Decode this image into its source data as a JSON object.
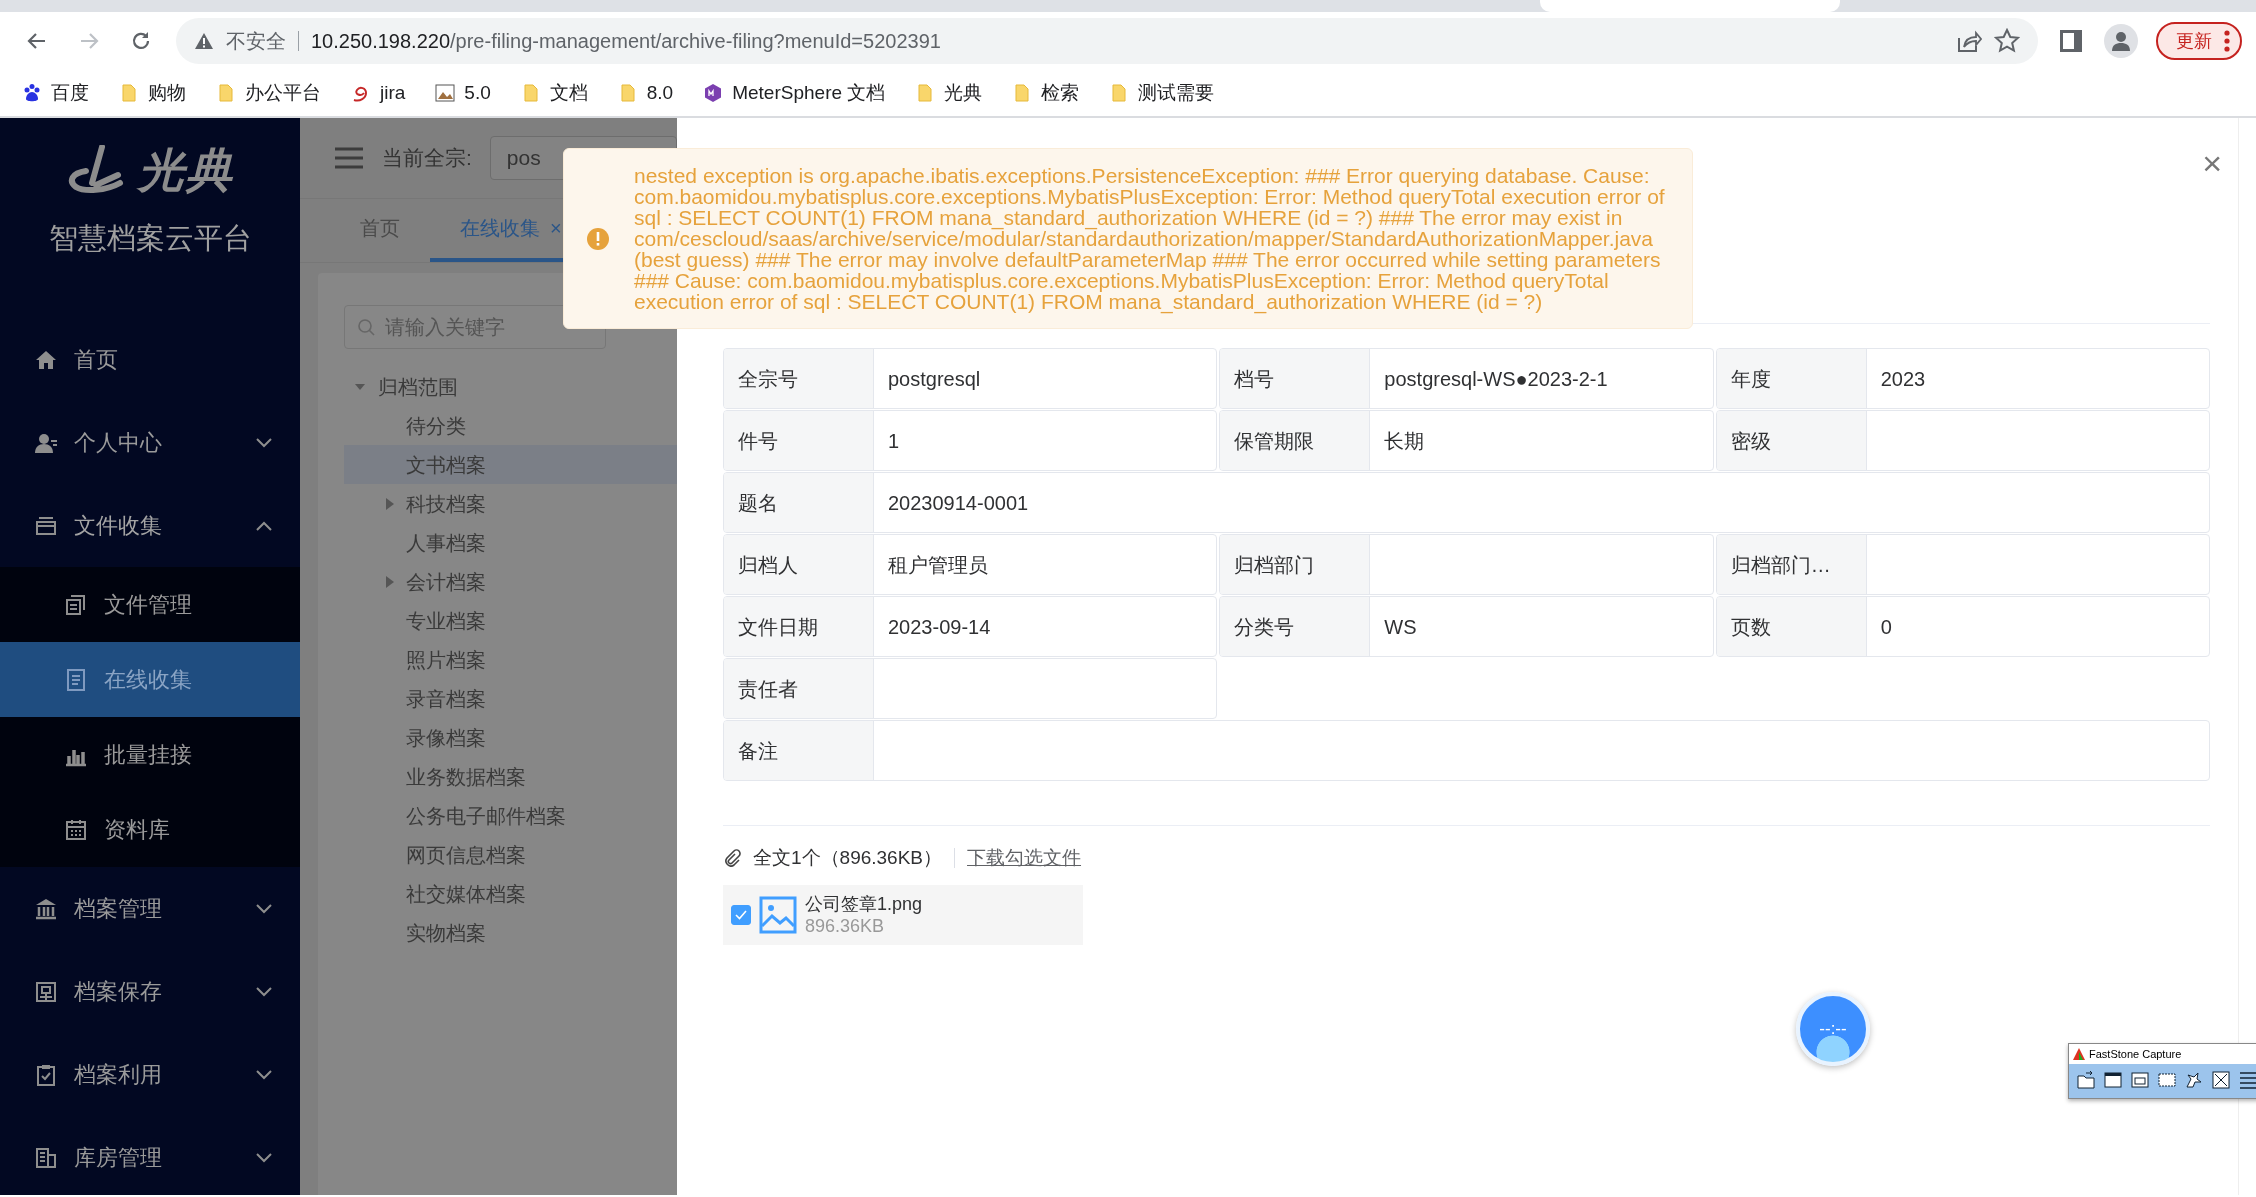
{
  "browser": {
    "security": "不安全",
    "url_host": "10.250.198.220",
    "url_path": "/pre-filing-management/archive-filing?menuId=5202391",
    "update_button": "更新",
    "bookmarks": [
      {
        "label": "百度",
        "kind": "paw"
      },
      {
        "label": "购物",
        "kind": "folder"
      },
      {
        "label": "办公平台",
        "kind": "folder"
      },
      {
        "label": "jira",
        "kind": "swirl"
      },
      {
        "label": "5.0",
        "kind": "image"
      },
      {
        "label": "文档",
        "kind": "folder"
      },
      {
        "label": "8.0",
        "kind": "folder"
      },
      {
        "label": "MeterSphere 文档",
        "kind": "hexagon"
      },
      {
        "label": "光典",
        "kind": "folder"
      },
      {
        "label": "检索",
        "kind": "folder"
      },
      {
        "label": "测试需要",
        "kind": "folder"
      }
    ]
  },
  "sidebar": {
    "logo_text": "光典",
    "platform_name": "智慧档案云平台",
    "items": [
      {
        "label": "首页"
      },
      {
        "label": "个人中心",
        "expanded": false
      },
      {
        "label": "文件收集",
        "expanded": true,
        "children": [
          {
            "label": "文件管理",
            "selected": false
          },
          {
            "label": "在线收集",
            "selected": true
          },
          {
            "label": "批量挂接",
            "selected": false
          },
          {
            "label": "资料库",
            "selected": false
          }
        ]
      },
      {
        "label": "档案管理",
        "expanded": false
      },
      {
        "label": "档案保存",
        "expanded": false
      },
      {
        "label": "档案利用",
        "expanded": false
      },
      {
        "label": "库房管理",
        "expanded": false
      }
    ]
  },
  "header": {
    "fonds_label": "当前全宗:",
    "fonds_value": "pos"
  },
  "tabs": [
    {
      "label": "首页",
      "selected": false
    },
    {
      "label": "在线收集",
      "selected": true,
      "close": "×"
    }
  ],
  "tree": {
    "search_placeholder": "请输入关键字",
    "root": {
      "label": "归档范围",
      "expanded": true,
      "children": [
        {
          "label": "待分类",
          "has_children": false,
          "selected": false
        },
        {
          "label": "文书档案",
          "has_children": false,
          "selected": true
        },
        {
          "label": "科技档案",
          "has_children": true,
          "selected": false
        },
        {
          "label": "人事档案",
          "has_children": false,
          "selected": false
        },
        {
          "label": "会计档案",
          "has_children": true,
          "selected": false
        },
        {
          "label": "专业档案",
          "has_children": false,
          "selected": false
        },
        {
          "label": "照片档案",
          "has_children": false,
          "selected": false
        },
        {
          "label": "录音档案",
          "has_children": false,
          "selected": false
        },
        {
          "label": "录像档案",
          "has_children": false,
          "selected": false
        },
        {
          "label": "业务数据档案",
          "has_children": false,
          "selected": false
        },
        {
          "label": "公务电子邮件档案",
          "has_children": false,
          "selected": false
        },
        {
          "label": "网页信息档案",
          "has_children": false,
          "selected": false
        },
        {
          "label": "社交媒体档案",
          "has_children": false,
          "selected": false
        },
        {
          "label": "实物档案",
          "has_children": false,
          "selected": false
        }
      ]
    }
  },
  "error_toast": {
    "message": "nested exception is org.apache.ibatis.exceptions.PersistenceException: ### Error querying database. Cause: com.baomidou.mybatisplus.core.exceptions.MybatisPlusException: Error: Method queryTotal execution error of sql : SELECT COUNT(1) FROM mana_standard_authorization WHERE (id = ?) ### The error may exist in com/cescloud/saas/archive/service/modular/standardauthorization/mapper/StandardAuthorizationMapper.java (best guess) ### The error may involve defaultParameterMap ### The error occurred while setting parameters ### Cause: com.baomidou.mybatisplus.core.exceptions.MybatisPlusException: Error: Method queryTotal execution error of sql : SELECT COUNT(1) FROM mana_standard_authorization WHERE (id = ?)"
  },
  "detail": {
    "close": "×",
    "rows": [
      [
        {
          "label": "全宗号",
          "value": "postgresql",
          "wide": false
        },
        {
          "label": "档号",
          "value": "postgresql-WS●2023-2-1",
          "wide": false
        },
        {
          "label": "年度",
          "value": "2023",
          "wide": false
        }
      ],
      [
        {
          "label": "件号",
          "value": "1",
          "wide": false
        },
        {
          "label": "保管期限",
          "value": "长期",
          "wide": false
        },
        {
          "label": "密级",
          "wide": false
        }
      ],
      [
        {
          "label": "题名",
          "value": "20230914-0001",
          "wide": true
        }
      ],
      [
        {
          "label": "归档人",
          "value": "租户管理员",
          "wide": false
        },
        {
          "label": "归档部门",
          "wide": false
        },
        {
          "label": "归档部门…",
          "wide": false
        }
      ],
      [
        {
          "label": "文件日期",
          "value": "2023-09-14",
          "wide": false
        },
        {
          "label": "分类号",
          "value": "WS",
          "wide": false
        },
        {
          "label": "页数",
          "value": "0",
          "wide": false
        }
      ],
      [
        {
          "label": "责任者",
          "wide": false
        }
      ],
      [
        {
          "label": "备注",
          "wide": true
        }
      ]
    ]
  },
  "attachments": {
    "summary": "全文1个（896.36KB）",
    "download_link": "下载勾选文件",
    "files": [
      {
        "name": "公司签章1.png",
        "size": "896.36KB",
        "checked": true
      }
    ]
  },
  "timer": {
    "text": "--:--"
  },
  "capture_toolbar": {
    "title": "FastStone Capture"
  }
}
